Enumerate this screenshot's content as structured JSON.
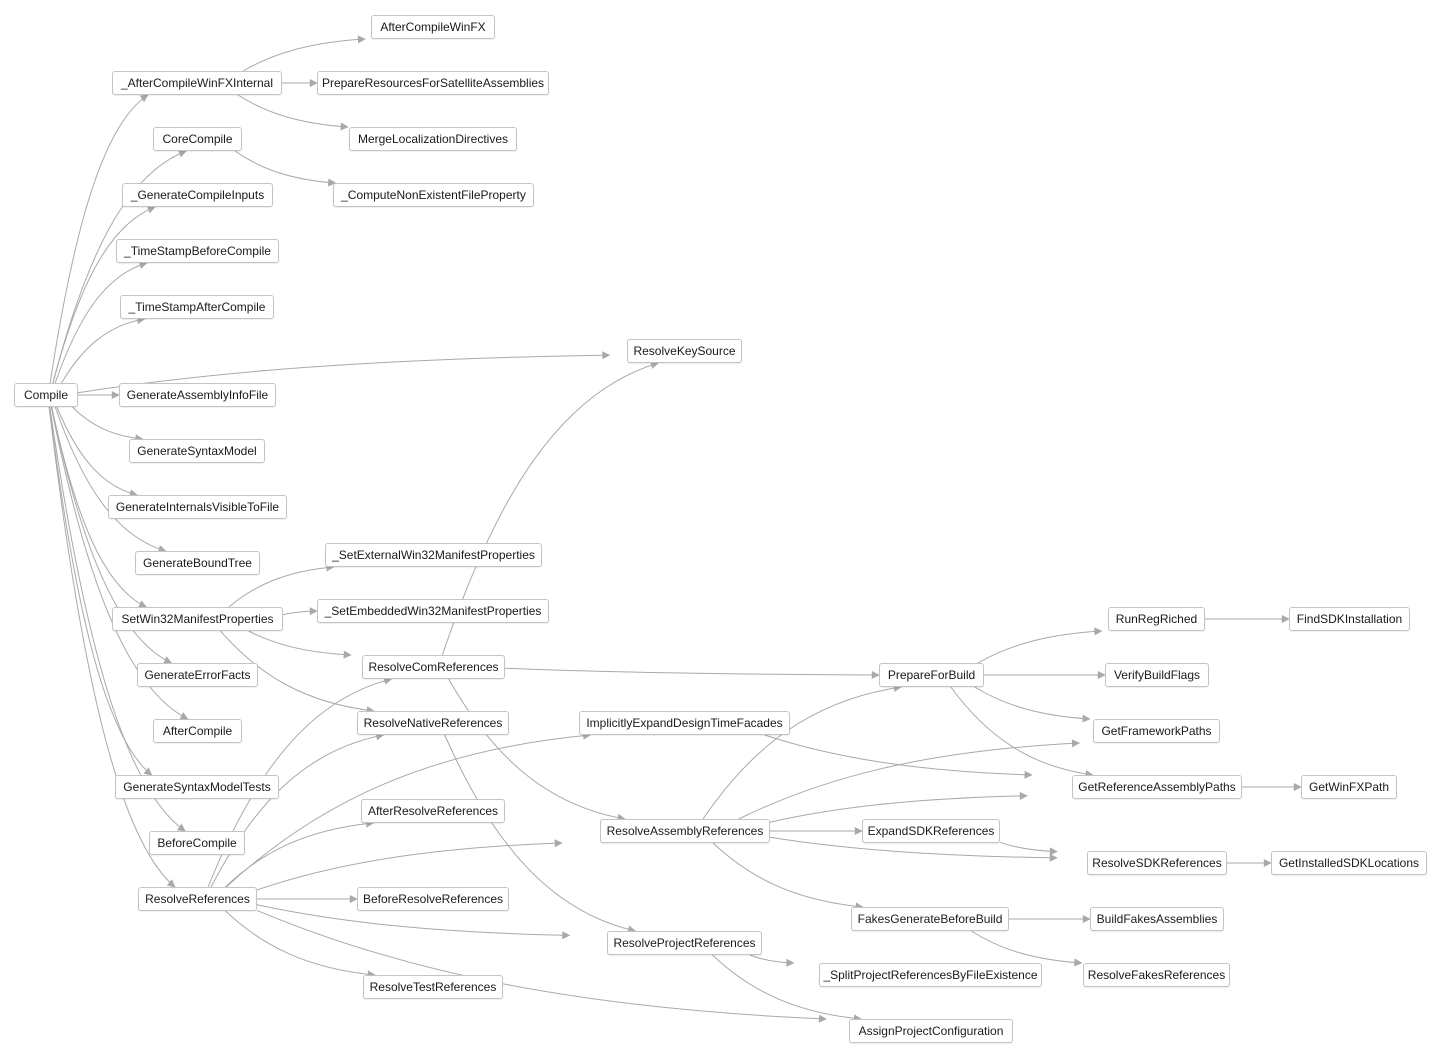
{
  "colors": {
    "edge": "#a9a9a9",
    "node_border": "#c4c4c4",
    "text": "#1a1a1a"
  },
  "nodes": {
    "AfterCompileWinFX": "AfterCompileWinFX",
    "_AfterCompileWinFXInternal": "_AfterCompileWinFXInternal",
    "PrepareResourcesForSatelliteAssemblies": "PrepareResourcesForSatelliteAssemblies",
    "CoreCompile": "CoreCompile",
    "MergeLocalizationDirectives": "MergeLocalizationDirectives",
    "_GenerateCompileInputs": "_GenerateCompileInputs",
    "_ComputeNonExistentFileProperty": "_ComputeNonExistentFileProperty",
    "_TimeStampBeforeCompile": "_TimeStampBeforeCompile",
    "_TimeStampAfterCompile": "_TimeStampAfterCompile",
    "ResolveKeySource": "ResolveKeySource",
    "Compile": "Compile",
    "GenerateAssemblyInfoFile": "GenerateAssemblyInfoFile",
    "GenerateSyntaxModel": "GenerateSyntaxModel",
    "GenerateInternalsVisibleToFile": "GenerateInternalsVisibleToFile",
    "GenerateBoundTree": "GenerateBoundTree",
    "_SetExternalWin32ManifestProperties": "_SetExternalWin32ManifestProperties",
    "SetWin32ManifestProperties": "SetWin32ManifestProperties",
    "_SetEmbeddedWin32ManifestProperties": "_SetEmbeddedWin32ManifestProperties",
    "GenerateErrorFacts": "GenerateErrorFacts",
    "ResolveComReferences": "ResolveComReferences",
    "AfterCompile": "AfterCompile",
    "ResolveNativeReferences": "ResolveNativeReferences",
    "ImplicitlyExpandDesignTimeFacades": "ImplicitlyExpandDesignTimeFacades",
    "GenerateSyntaxModelTests": "GenerateSyntaxModelTests",
    "AfterResolveReferences": "AfterResolveReferences",
    "BeforeCompile": "BeforeCompile",
    "ResolveReferences": "ResolveReferences",
    "BeforeResolveReferences": "BeforeResolveReferences",
    "ResolveTestReferences": "ResolveTestReferences",
    "ResolveAssemblyReferences": "ResolveAssemblyReferences",
    "ResolveProjectReferences": "ResolveProjectReferences",
    "PrepareForBuild": "PrepareForBuild",
    "RunRegRiched": "RunRegRiched",
    "FindSDKInstallation": "FindSDKInstallation",
    "VerifyBuildFlags": "VerifyBuildFlags",
    "GetFrameworkPaths": "GetFrameworkPaths",
    "GetReferenceAssemblyPaths": "GetReferenceAssemblyPaths",
    "GetWinFXPath": "GetWinFXPath",
    "ExpandSDKReferences": "ExpandSDKReferences",
    "ResolveSDKReferences": "ResolveSDKReferences",
    "GetInstalledSDKLocations": "GetInstalledSDKLocations",
    "FakesGenerateBeforeBuild": "FakesGenerateBeforeBuild",
    "BuildFakesAssemblies": "BuildFakesAssemblies",
    "_SplitProjectReferencesByFileExistence": "_SplitProjectReferencesByFileExistence",
    "ResolveFakesReferences": "ResolveFakesReferences",
    "AssignProjectConfiguration": "AssignProjectConfiguration"
  },
  "edges": [
    [
      "Compile",
      "_AfterCompileWinFXInternal"
    ],
    [
      "Compile",
      "CoreCompile"
    ],
    [
      "Compile",
      "_GenerateCompileInputs"
    ],
    [
      "Compile",
      "_TimeStampBeforeCompile"
    ],
    [
      "Compile",
      "_TimeStampAfterCompile"
    ],
    [
      "Compile",
      "ResolveKeySource"
    ],
    [
      "Compile",
      "GenerateAssemblyInfoFile"
    ],
    [
      "Compile",
      "GenerateSyntaxModel"
    ],
    [
      "Compile",
      "GenerateInternalsVisibleToFile"
    ],
    [
      "Compile",
      "GenerateBoundTree"
    ],
    [
      "Compile",
      "SetWin32ManifestProperties"
    ],
    [
      "Compile",
      "GenerateErrorFacts"
    ],
    [
      "Compile",
      "AfterCompile"
    ],
    [
      "Compile",
      "GenerateSyntaxModelTests"
    ],
    [
      "Compile",
      "BeforeCompile"
    ],
    [
      "Compile",
      "ResolveReferences"
    ],
    [
      "_AfterCompileWinFXInternal",
      "AfterCompileWinFX"
    ],
    [
      "_AfterCompileWinFXInternal",
      "PrepareResourcesForSatelliteAssemblies"
    ],
    [
      "_AfterCompileWinFXInternal",
      "MergeLocalizationDirectives"
    ],
    [
      "CoreCompile",
      "_ComputeNonExistentFileProperty"
    ],
    [
      "SetWin32ManifestProperties",
      "_SetExternalWin32ManifestProperties"
    ],
    [
      "SetWin32ManifestProperties",
      "_SetEmbeddedWin32ManifestProperties"
    ],
    [
      "SetWin32ManifestProperties",
      "ResolveComReferences"
    ],
    [
      "SetWin32ManifestProperties",
      "ResolveNativeReferences"
    ],
    [
      "ResolveComReferences",
      "ResolveKeySource"
    ],
    [
      "ResolveComReferences",
      "PrepareForBuild"
    ],
    [
      "ResolveComReferences",
      "ResolveAssemblyReferences"
    ],
    [
      "ResolveNativeReferences",
      "ResolveProjectReferences"
    ],
    [
      "ResolveReferences",
      "ResolveComReferences"
    ],
    [
      "ResolveReferences",
      "ResolveNativeReferences"
    ],
    [
      "ResolveReferences",
      "ImplicitlyExpandDesignTimeFacades"
    ],
    [
      "ResolveReferences",
      "AfterResolveReferences"
    ],
    [
      "ResolveReferences",
      "ResolveAssemblyReferences"
    ],
    [
      "ResolveReferences",
      "BeforeResolveReferences"
    ],
    [
      "ResolveReferences",
      "ResolveProjectReferences"
    ],
    [
      "ResolveReferences",
      "ResolveTestReferences"
    ],
    [
      "ResolveReferences",
      "AssignProjectConfiguration"
    ],
    [
      "ImplicitlyExpandDesignTimeFacades",
      "GetReferenceAssemblyPaths"
    ],
    [
      "ResolveAssemblyReferences",
      "PrepareForBuild"
    ],
    [
      "ResolveAssemblyReferences",
      "GetFrameworkPaths"
    ],
    [
      "ResolveAssemblyReferences",
      "GetReferenceAssemblyPaths"
    ],
    [
      "ResolveAssemblyReferences",
      "ExpandSDKReferences"
    ],
    [
      "ResolveAssemblyReferences",
      "ResolveSDKReferences"
    ],
    [
      "ResolveAssemblyReferences",
      "FakesGenerateBeforeBuild"
    ],
    [
      "PrepareForBuild",
      "RunRegRiched"
    ],
    [
      "PrepareForBuild",
      "VerifyBuildFlags"
    ],
    [
      "PrepareForBuild",
      "GetFrameworkPaths"
    ],
    [
      "PrepareForBuild",
      "GetReferenceAssemblyPaths"
    ],
    [
      "RunRegRiched",
      "FindSDKInstallation"
    ],
    [
      "GetReferenceAssemblyPaths",
      "GetWinFXPath"
    ],
    [
      "ExpandSDKReferences",
      "ResolveSDKReferences"
    ],
    [
      "ResolveSDKReferences",
      "GetInstalledSDKLocations"
    ],
    [
      "FakesGenerateBeforeBuild",
      "BuildFakesAssemblies"
    ],
    [
      "FakesGenerateBeforeBuild",
      "ResolveFakesReferences"
    ],
    [
      "ResolveProjectReferences",
      "_SplitProjectReferencesByFileExistence"
    ],
    [
      "ResolveProjectReferences",
      "AssignProjectConfiguration"
    ]
  ]
}
